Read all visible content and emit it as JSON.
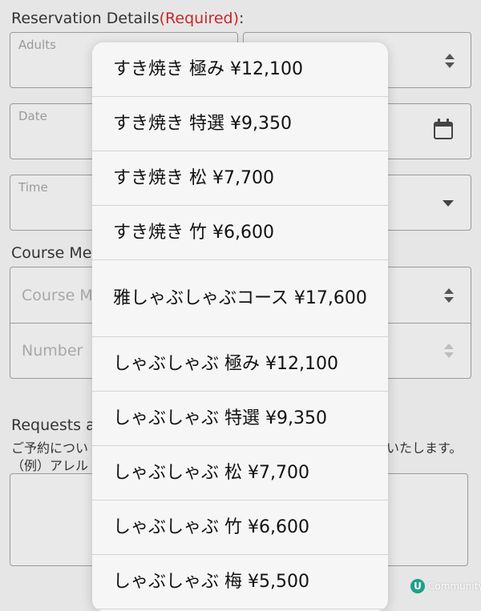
{
  "form": {
    "section_title": "Reservation Details",
    "required_tag": "(Required)",
    "colon": ":",
    "adults_label": "Adults",
    "date_label": "Date",
    "time_label": "Time",
    "course_section_title": "Course Me",
    "course_placeholder": "Course M",
    "number_placeholder": "Number",
    "requests_title": "Requests a",
    "note_line1_left": "ご予約につい",
    "note_line1_right": "いたします。",
    "note_line2": "（例）アレル"
  },
  "dropdown": {
    "options": [
      "すき焼き 極み ¥12,100",
      "すき焼き 特選 ¥9,350",
      "すき焼き 松 ¥7,700",
      "すき焼き 竹 ¥6,600",
      "雅しゃぶしゃぶコース ¥17,600",
      "しゃぶしゃぶ 極み ¥12,100",
      "しゃぶしゃぶ 特選 ¥9,350",
      "しゃぶしゃぶ 松 ¥7,700",
      "しゃぶしゃぶ 竹 ¥6,600",
      "しゃぶしゃぶ 梅 ¥5,500"
    ]
  },
  "watermark": {
    "logo": "U",
    "text": "Community"
  },
  "colors": {
    "required": "#c62828",
    "field_border": "#9a9a9a",
    "dropdown_bg": "#f6f6f6"
  },
  "icons": [
    "sort-arrows-icon",
    "calendar-icon",
    "chevron-down-icon"
  ]
}
